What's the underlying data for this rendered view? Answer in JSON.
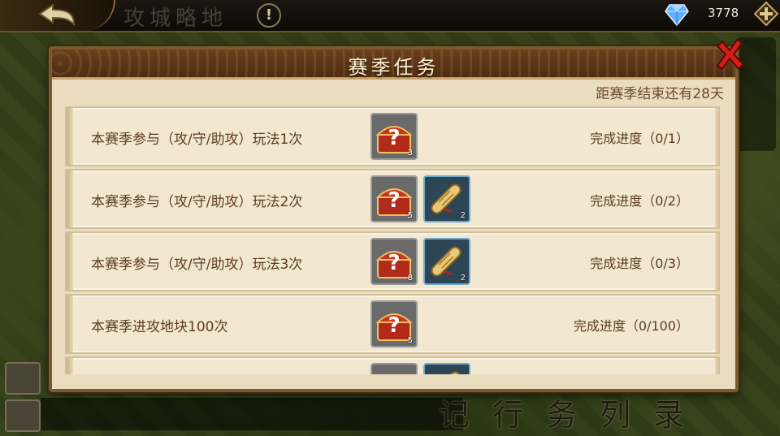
{
  "topbar": {
    "title": "攻城略地",
    "gem_count": "3778"
  },
  "dialog": {
    "title": "赛季任务",
    "countdown": "距赛季结束还有28天",
    "tasks": [
      {
        "text": "本赛季参与（攻/守/助攻）玩法1次",
        "progress": "完成进度（0/1）",
        "rewards": [
          {
            "icon": "treasure-chest-icon",
            "qty": "3"
          }
        ]
      },
      {
        "text": "本赛季参与（攻/守/助攻）玩法2次",
        "progress": "完成进度（0/2）",
        "rewards": [
          {
            "icon": "treasure-chest-icon",
            "qty": "5"
          },
          {
            "icon": "scroll-icon",
            "qty": "2"
          }
        ]
      },
      {
        "text": "本赛季参与（攻/守/助攻）玩法3次",
        "progress": "完成进度（0/3）",
        "rewards": [
          {
            "icon": "treasure-chest-icon",
            "qty": "8"
          },
          {
            "icon": "scroll-icon",
            "qty": "2"
          }
        ]
      },
      {
        "text": "本赛季进攻地块100次",
        "progress": "完成进度（0/100）",
        "rewards": [
          {
            "icon": "treasure-chest-icon",
            "qty": "5"
          }
        ]
      },
      {
        "text": "",
        "progress": "",
        "rewards": [
          {
            "icon": "treasure-chest-icon",
            "qty": ""
          },
          {
            "icon": "scroll-icon",
            "qty": ""
          }
        ]
      }
    ]
  },
  "background": {
    "bottom_text": "记行务列录"
  },
  "colors": {
    "accent": "#7a5a2e",
    "panel": "#e9dcbf",
    "header": "#5a3416",
    "text": "#5b3b22"
  }
}
